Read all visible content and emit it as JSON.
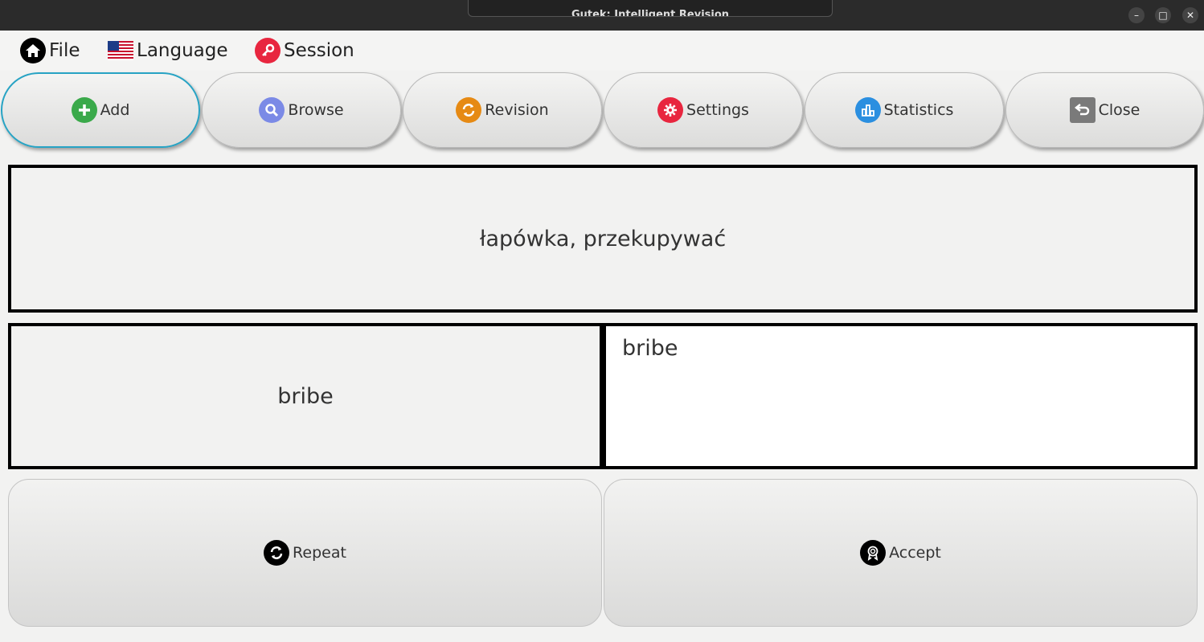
{
  "window": {
    "title": "Gutek: Intelligent Revision",
    "minimize": "–",
    "maximize": "□",
    "close": "✕"
  },
  "menu": {
    "file": "File",
    "language": "Language",
    "session": "Session"
  },
  "toolbar": {
    "add": "Add",
    "browse": "Browse",
    "revision": "Revision",
    "settings": "Settings",
    "statistics": "Statistics",
    "close": "Close"
  },
  "card": {
    "question": "łapówka, przekupywać",
    "expected_answer": "bribe",
    "user_answer": "bribe"
  },
  "actions": {
    "repeat": "Repeat",
    "accept": "Accept"
  },
  "colors": {
    "add": "#3aa94a",
    "browse": "#7b8ae6",
    "revision": "#e68a14",
    "settings": "#e8263f",
    "statistics": "#2b8fe0",
    "close": "#7a7a7a",
    "active_border": "#27a3c4",
    "session": "#e8263f"
  }
}
